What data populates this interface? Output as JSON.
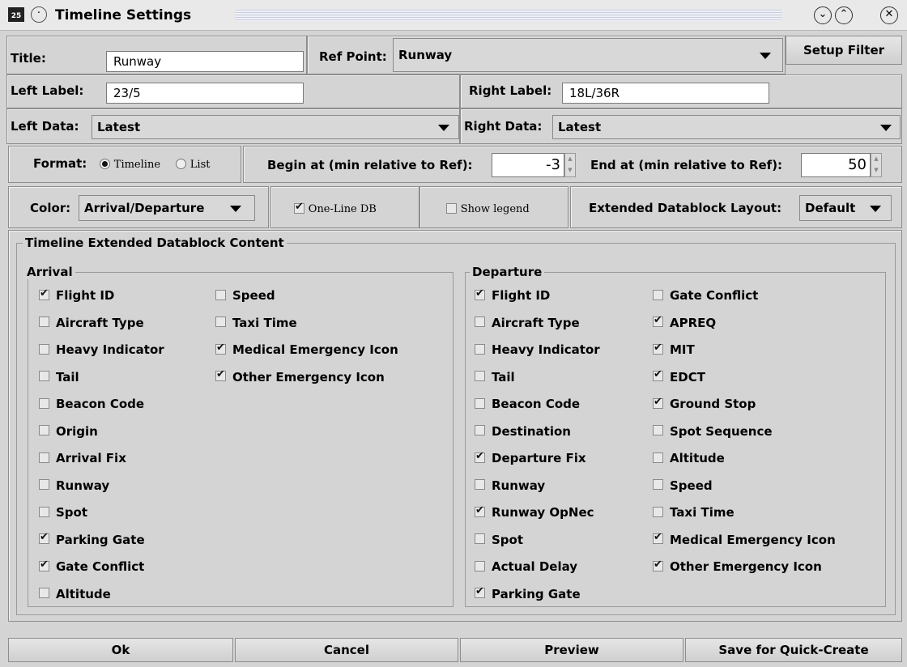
{
  "window": {
    "app_icon": "25",
    "title": "Timeline Settings"
  },
  "top": {
    "title_label": "Title:",
    "title_value": "Runway",
    "ref_point_label": "Ref Point:",
    "ref_point_value": "Runway",
    "setup_filter": "Setup Filter",
    "left_label_label": "Left Label:",
    "left_label_value": "23/5",
    "right_label_label": "Right Label:",
    "right_label_value": "18L/36R",
    "left_data_label": "Left Data:",
    "left_data_value": "Latest",
    "right_data_label": "Right Data:",
    "right_data_value": "Latest"
  },
  "format": {
    "label": "Format:",
    "timeline": "Timeline",
    "list": "List",
    "selected": "Timeline",
    "begin_label": "Begin at (min relative to Ref):",
    "begin_value": "-3",
    "end_label": "End at (min relative to Ref):",
    "end_value": "50"
  },
  "options": {
    "color_label": "Color:",
    "color_value": "Arrival/Departure",
    "one_line_db": "One-Line DB",
    "one_line_db_checked": true,
    "show_legend": "Show legend",
    "show_legend_checked": false,
    "ext_layout_label": "Extended Datablock Layout:",
    "ext_layout_value": "Default"
  },
  "content": {
    "title": "Timeline Extended Datablock Content",
    "arrival_title": "Arrival",
    "departure_title": "Departure",
    "arrival": [
      [
        {
          "label": "Flight ID",
          "checked": true
        },
        {
          "label": "Aircraft Type",
          "checked": false
        },
        {
          "label": "Heavy Indicator",
          "checked": false
        },
        {
          "label": "Tail",
          "checked": false
        },
        {
          "label": "Beacon Code",
          "checked": false
        },
        {
          "label": "Origin",
          "checked": false
        },
        {
          "label": "Arrival Fix",
          "checked": false
        },
        {
          "label": "Runway",
          "checked": false
        },
        {
          "label": "Spot",
          "checked": false
        },
        {
          "label": "Parking Gate",
          "checked": true
        },
        {
          "label": "Gate Conflict",
          "checked": true
        },
        {
          "label": "Altitude",
          "checked": false
        }
      ],
      [
        {
          "label": "Speed",
          "checked": false
        },
        {
          "label": "Taxi Time",
          "checked": false
        },
        {
          "label": "Medical Emergency Icon",
          "checked": true
        },
        {
          "label": "Other Emergency Icon",
          "checked": true
        }
      ]
    ],
    "departure": [
      [
        {
          "label": "Flight ID",
          "checked": true
        },
        {
          "label": "Aircraft Type",
          "checked": false
        },
        {
          "label": "Heavy Indicator",
          "checked": false
        },
        {
          "label": "Tail",
          "checked": false
        },
        {
          "label": "Beacon Code",
          "checked": false
        },
        {
          "label": "Destination",
          "checked": false
        },
        {
          "label": "Departure Fix",
          "checked": true
        },
        {
          "label": "Runway",
          "checked": false
        },
        {
          "label": "Runway OpNec",
          "checked": true
        },
        {
          "label": "Spot",
          "checked": false
        },
        {
          "label": "Actual Delay",
          "checked": false
        },
        {
          "label": "Parking Gate",
          "checked": true
        }
      ],
      [
        {
          "label": "Gate Conflict",
          "checked": false
        },
        {
          "label": "APREQ",
          "checked": true
        },
        {
          "label": "MIT",
          "checked": true
        },
        {
          "label": "EDCT",
          "checked": true
        },
        {
          "label": "Ground Stop",
          "checked": true
        },
        {
          "label": "Spot Sequence",
          "checked": false
        },
        {
          "label": "Altitude",
          "checked": false
        },
        {
          "label": "Speed",
          "checked": false
        },
        {
          "label": "Taxi Time",
          "checked": false
        },
        {
          "label": "Medical Emergency Icon",
          "checked": true
        },
        {
          "label": "Other Emergency Icon",
          "checked": true
        }
      ]
    ]
  },
  "buttons": {
    "ok": "Ok",
    "cancel": "Cancel",
    "preview": "Preview",
    "save": "Save for Quick-Create"
  }
}
